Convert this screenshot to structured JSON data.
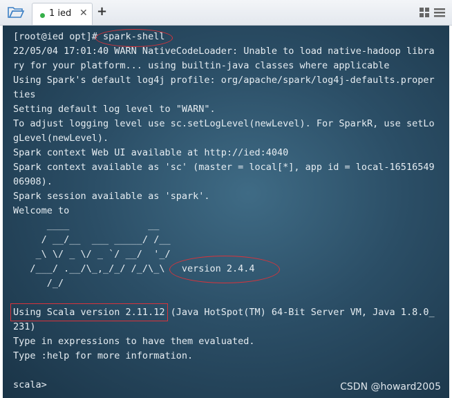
{
  "tab": {
    "label": "1 ied",
    "close": "✕",
    "add": "+"
  },
  "terminal": {
    "lines": [
      "[root@ied opt]# spark-shell",
      "22/05/04 17:01:40 WARN NativeCodeLoader: Unable to load native-hadoop libra",
      "ry for your platform... using builtin-java classes where applicable",
      "Using Spark's default log4j profile: org/apache/spark/log4j-defaults.proper",
      "ties",
      "Setting default log level to \"WARN\".",
      "To adjust logging level use sc.setLogLevel(newLevel). For SparkR, use setLo",
      "gLevel(newLevel).",
      "Spark context Web UI available at http://ied:4040",
      "Spark context available as 'sc' (master = local[*], app id = local-16516549",
      "06908).",
      "Spark session available as 'spark'.",
      "Welcome to",
      "      ____              __",
      "     / __/__  ___ _____/ /__",
      "    _\\ \\/ _ \\/ _ `/ __/  '_/",
      "   /___/ .__/\\_,_/_/ /_/\\_\\   version 2.4.4",
      "      /_/",
      "",
      "Using Scala version 2.11.12 (Java HotSpot(TM) 64-Bit Server VM, Java 1.8.0_",
      "231)",
      "Type in expressions to have them evaluated.",
      "Type :help for more information.",
      "",
      "scala> "
    ]
  },
  "watermark": "CSDN @howard2005",
  "colors": {
    "annotation": "#d9333b",
    "tab_dot": "#36b04a"
  }
}
